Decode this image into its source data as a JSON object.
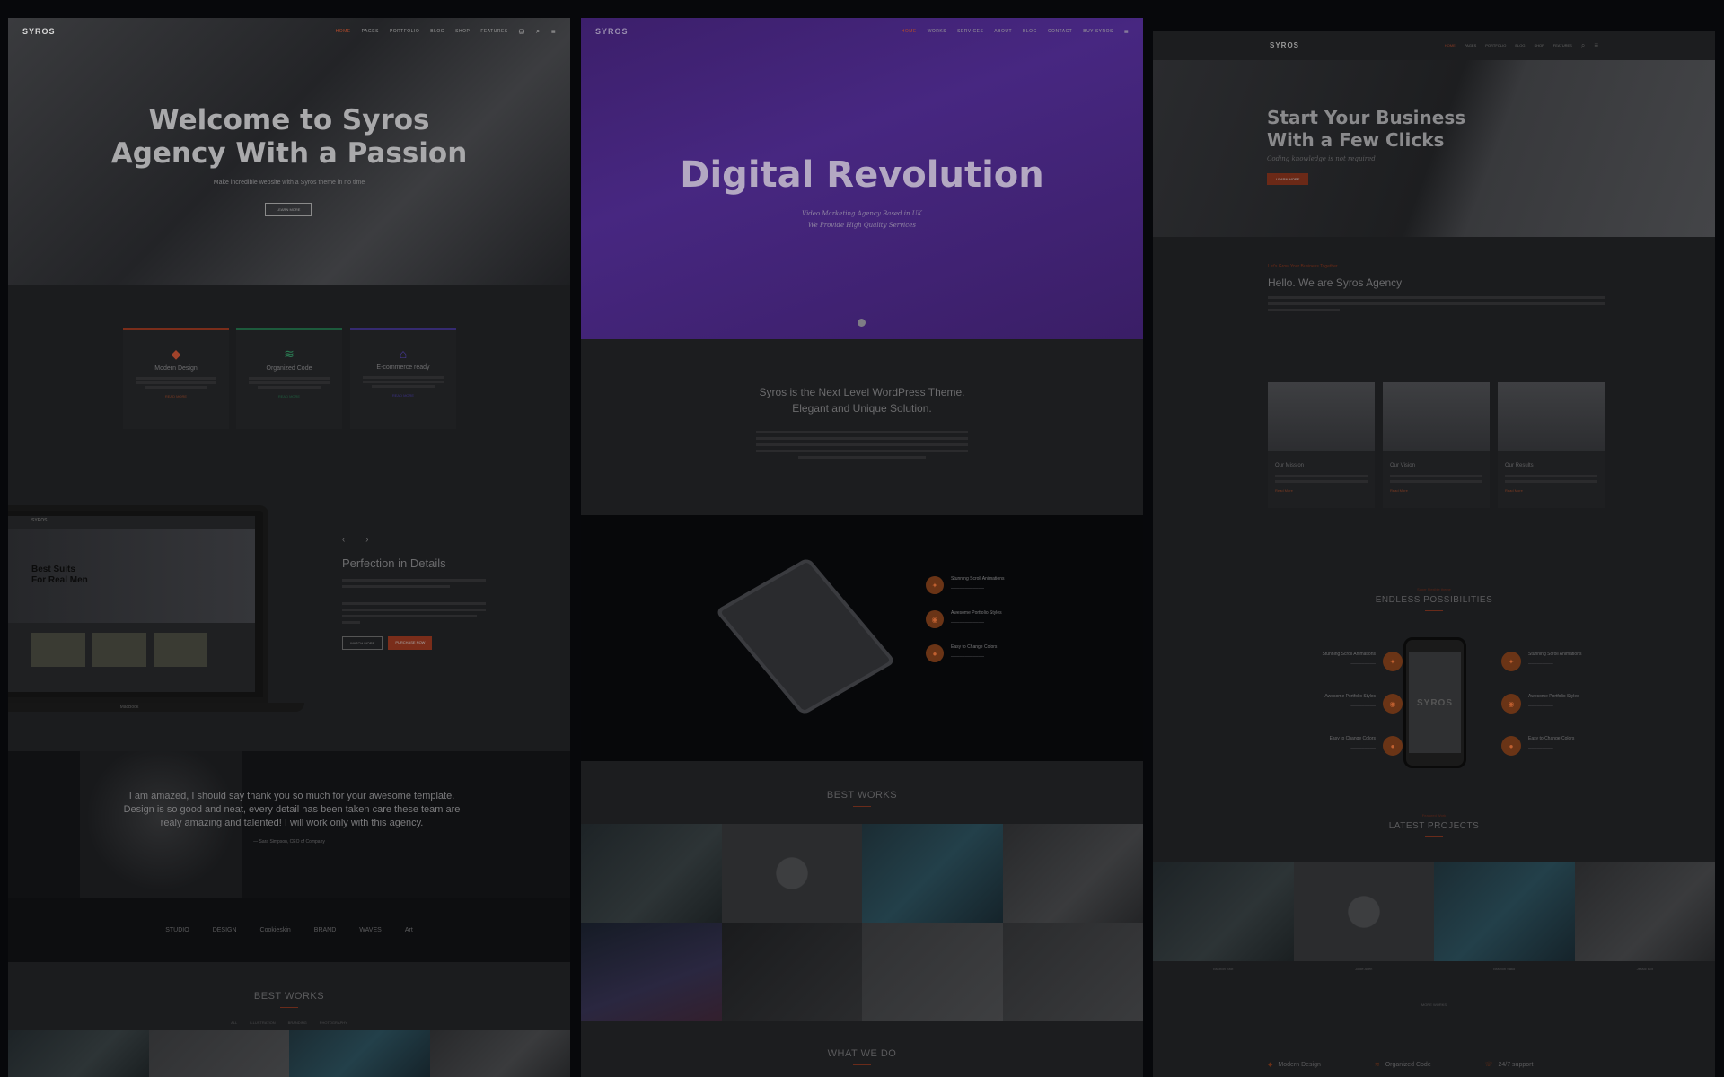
{
  "col1": {
    "nav": {
      "logo": "SYROS",
      "items": [
        "HOME",
        "PAGES",
        "PORTFOLIO",
        "BLOG",
        "SHOP",
        "FEATURES"
      ],
      "active_index": 0
    },
    "hero": {
      "title_line1": "Welcome to Syros",
      "title_line2": "Agency With a Passion",
      "subtitle": "Make incredible website with a Syros theme in no time",
      "button": "LEARN MORE"
    },
    "features": [
      {
        "title": "Modern Design",
        "icon": "diamond-icon",
        "color": "#b34a2a",
        "link": "READ MORE"
      },
      {
        "title": "Organized Code",
        "icon": "layers-icon",
        "color": "#2a8a5a",
        "link": "READ MORE"
      },
      {
        "title": "E-commerce ready",
        "icon": "bag-icon",
        "color": "#4a3aa0",
        "link": "READ MORE"
      }
    ],
    "laptop": {
      "logo": "SYROS",
      "hero_line1": "Best Suits",
      "hero_line2": "For Real Men",
      "label": "MacBook"
    },
    "perfection": {
      "title": "Perfection in Details",
      "btn_primary": "WATCH MORE",
      "btn_secondary": "PURCHASE NOW"
    },
    "testimonial": {
      "quote": "I am amazed, I should say thank you so much for your awesome template. Design is so good and neat, every detail has been taken care these team are realy amazing and talented! I will work only with this agency.",
      "author": "— Sara Simpson, CEO of Company"
    },
    "clients": [
      "STUDIO",
      "DESIGN",
      "Cookieskin",
      "BRAND",
      "WAVES",
      "Art"
    ],
    "works": {
      "title": "BEST WORKS",
      "filters": [
        "ALL",
        "ILLUSTRATION",
        "BRANDING",
        "PHOTOGRAPHY"
      ]
    }
  },
  "col2": {
    "nav": {
      "logo": "SYROS",
      "items": [
        "HOME",
        "WORKS",
        "SERVICES",
        "ABOUT",
        "BLOG",
        "CONTACT",
        "BUY SYROS"
      ],
      "active_index": 0
    },
    "hero": {
      "title": "Digital Revolution",
      "sub_line1": "Video Marketing Agency Based in UK",
      "sub_line2": "We Provide High Quality Services"
    },
    "intro": {
      "line1": "Syros is the Next Level WordPress Theme.",
      "line2": "Elegant and Unique Solution."
    },
    "features": [
      {
        "title": "Stunning Scroll Animations",
        "icon": "bulb-icon"
      },
      {
        "title": "Awesome Portfolio Styles",
        "icon": "camera-icon"
      },
      {
        "title": "Easy to Change Colors",
        "icon": "drop-icon"
      }
    ],
    "works_title": "BEST WORKS",
    "what_title": "WHAT WE DO"
  },
  "col3": {
    "nav": {
      "logo": "SYROS",
      "items": [
        "HOME",
        "PAGES",
        "PORTFOLIO",
        "BLOG",
        "SHOP",
        "FEATURES"
      ],
      "active_index": 0
    },
    "hero": {
      "title_line1": "Start Your Business",
      "title_line2": "With a Few Clicks",
      "subtitle": "Coding knowledge is not required",
      "button": "LEARN MORE"
    },
    "about": {
      "kicker": "Let's Grow Your Business Together",
      "title": "Hello. We are Syros Agency"
    },
    "cards": [
      {
        "title": "Our Mission",
        "link": "Read More"
      },
      {
        "title": "Our Vision",
        "link": "Read More"
      },
      {
        "title": "Our Results",
        "link": "Read More"
      }
    ],
    "possibilities": {
      "kicker": "Super Flexible theme",
      "title": "ENDLESS POSSIBILITIES",
      "phone_text": "SYROS",
      "left": [
        "Stunning Scroll Animations",
        "Awesome Portfolio Styles",
        "Easy to Change Colors"
      ],
      "right": [
        "Stunning Scroll Animations",
        "Awesome Portfolio Styles",
        "Easy to Change Colors"
      ]
    },
    "latest": {
      "kicker": "Featured Work",
      "title": "LATEST PROJECTS",
      "captions": [
        "Braxton Brot",
        "Jodie Allen",
        "Braxton Sako",
        "Jessic Bot"
      ],
      "more": "MORE WORKS"
    },
    "bottom": [
      {
        "title": "Modern Design",
        "icon": "diamond-icon"
      },
      {
        "title": "Organized Code",
        "icon": "layers-icon"
      },
      {
        "title": "24/7 support",
        "icon": "support-icon"
      }
    ]
  }
}
